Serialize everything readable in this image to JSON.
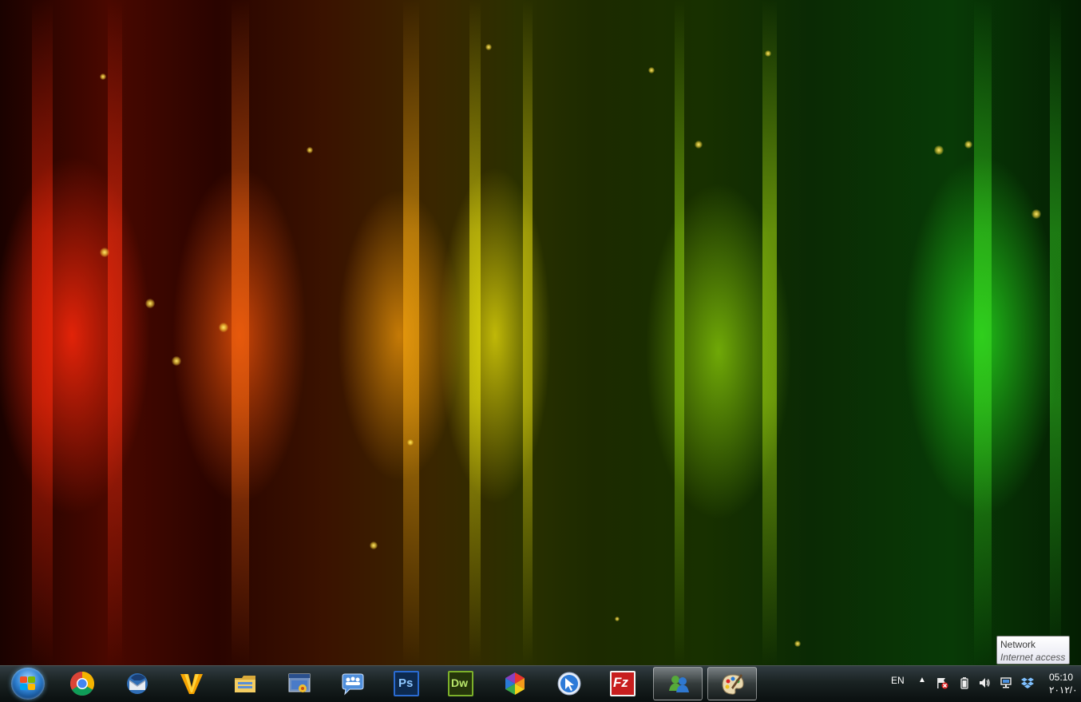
{
  "tooltip": {
    "title": "Network",
    "subtitle": "Internet access"
  },
  "taskbar": {
    "start_icon": "windows-start-orb",
    "apps": [
      {
        "name": "chrome",
        "icon": "chrome-icon",
        "active": false
      },
      {
        "name": "thunderbird",
        "icon": "thunderbird-icon",
        "active": false
      },
      {
        "name": "vectorworks",
        "icon": "v-logo-icon",
        "active": false
      },
      {
        "name": "explorer",
        "icon": "folder-icon",
        "active": false
      },
      {
        "name": "windows-app",
        "icon": "window-icon",
        "active": false
      },
      {
        "name": "people",
        "icon": "people-chat-icon",
        "active": false
      },
      {
        "name": "photoshop",
        "icon": "photoshop-icon",
        "label": "Ps",
        "active": false
      },
      {
        "name": "dreamweaver",
        "icon": "dreamweaver-icon",
        "label": "Dw",
        "active": false
      },
      {
        "name": "picasa",
        "icon": "pinwheel-icon",
        "active": false
      },
      {
        "name": "cursor-app",
        "icon": "blue-cursor-icon",
        "active": false
      },
      {
        "name": "filezilla",
        "icon": "filezilla-icon",
        "label": "Fz",
        "active": false
      },
      {
        "name": "messenger",
        "icon": "messenger-icon",
        "active": true
      },
      {
        "name": "paint",
        "icon": "paint-icon",
        "active": true
      }
    ],
    "colors": {
      "chrome_red": "#db4437",
      "ps_blue": "#2a6bd1",
      "dw_green": "#4a7a1a",
      "fz_red": "#c81e1e"
    }
  },
  "tray": {
    "language": "EN",
    "show_hidden_icon": "up-arrow-icon",
    "icons": [
      "flag-error-icon",
      "battery-icon",
      "volume-icon",
      "network-icon",
      "dropbox-icon"
    ],
    "time": "05:10",
    "date": "۲۰۱۲/۰"
  }
}
